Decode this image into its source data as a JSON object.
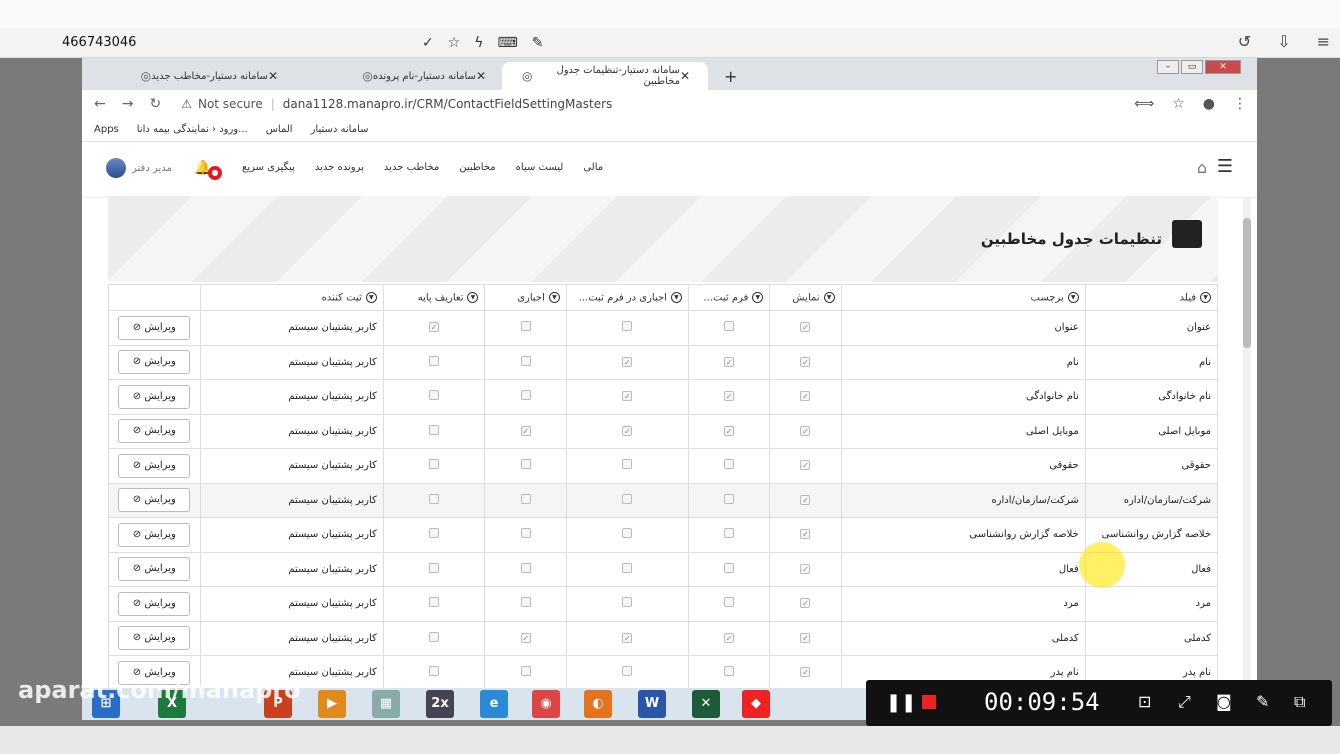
{
  "outer": {
    "address": "466743046"
  },
  "tabs": [
    {
      "label": "سامانه دستیار-مخاطب جدید"
    },
    {
      "label": "سامانه دستیار-نام پرونده"
    },
    {
      "label": "سامانه دستیار-تنظیمات جدول مخاطبین"
    }
  ],
  "url": {
    "not_secure": "Not secure",
    "address": "dana1128.manapro.ir/CRM/ContactFieldSettingMasters"
  },
  "bookmarks": [
    "Apps",
    "ورود ‹ نمایندگی بیمه دانا...",
    "الماس",
    "سامانه دستیار"
  ],
  "nav": {
    "items": [
      "مالی",
      "لیست سیاه",
      "مخاطبین",
      "مخاطب جدید",
      "پرونده جدید",
      "پیگیری سریع"
    ],
    "user": "مدیر دفتر"
  },
  "page": {
    "title": "تنظیمات جدول مخاطبین"
  },
  "table": {
    "headers": [
      "فیلد",
      "برچسب",
      "نمایش",
      "فرم ثبت...",
      "اجباری در فرم ثبت...",
      "اجباری",
      "تعاریف پایه",
      "ثبت کننده",
      ""
    ],
    "edit_label": "ویرایش",
    "rows": [
      {
        "field": "عنوان",
        "label": "عنوان",
        "creator": "کاربر پشتیبان سیستم",
        "flags": [
          1,
          0,
          0,
          0,
          1
        ]
      },
      {
        "field": "نام",
        "label": "نام",
        "creator": "کاربر پشتیبان سیستم",
        "flags": [
          1,
          1,
          1,
          0,
          0
        ]
      },
      {
        "field": "نام خانوادگی",
        "label": "نام خانوادگی",
        "creator": "کاربر پشتیبان سیستم",
        "flags": [
          1,
          1,
          1,
          0,
          0
        ]
      },
      {
        "field": "موبایل اصلی",
        "label": "موبایل اصلی",
        "creator": "کاربر پشتیبان سیستم",
        "flags": [
          1,
          1,
          1,
          1,
          0
        ]
      },
      {
        "field": "حقوقی",
        "label": "حقوقی",
        "creator": "کاربر پشتیبان سیستم",
        "flags": [
          1,
          0,
          0,
          0,
          0
        ]
      },
      {
        "field": "شرکت/سازمان/اداره",
        "label": "شرکت/سازمان/اداره",
        "creator": "کاربر پشتیبان سیستم",
        "flags": [
          1,
          0,
          0,
          0,
          0
        ]
      },
      {
        "field": "خلاصه گزارش روانشناسی",
        "label": "خلاصه گزارش روانشناسی",
        "creator": "کاربر پشتیبان سیستم",
        "flags": [
          1,
          0,
          0,
          0,
          0
        ]
      },
      {
        "field": "فعال",
        "label": "فعال",
        "creator": "کاربر پشتیبان سیستم",
        "flags": [
          1,
          0,
          0,
          0,
          0
        ]
      },
      {
        "field": "مرد",
        "label": "مرد",
        "creator": "کاربر پشتیبان سیستم",
        "flags": [
          1,
          0,
          0,
          0,
          0
        ]
      },
      {
        "field": "کدملی",
        "label": "کدملی",
        "creator": "کاربر پشتیبان سیستم",
        "flags": [
          1,
          1,
          1,
          1,
          0
        ]
      },
      {
        "field": "نام پدر",
        "label": "نام پدر",
        "creator": "کاربر پشتیبان سیستم",
        "flags": [
          1,
          0,
          0,
          0,
          0
        ]
      }
    ]
  },
  "recorder": {
    "time": "00:09:54"
  },
  "watermark": "aparat.com/manapro"
}
